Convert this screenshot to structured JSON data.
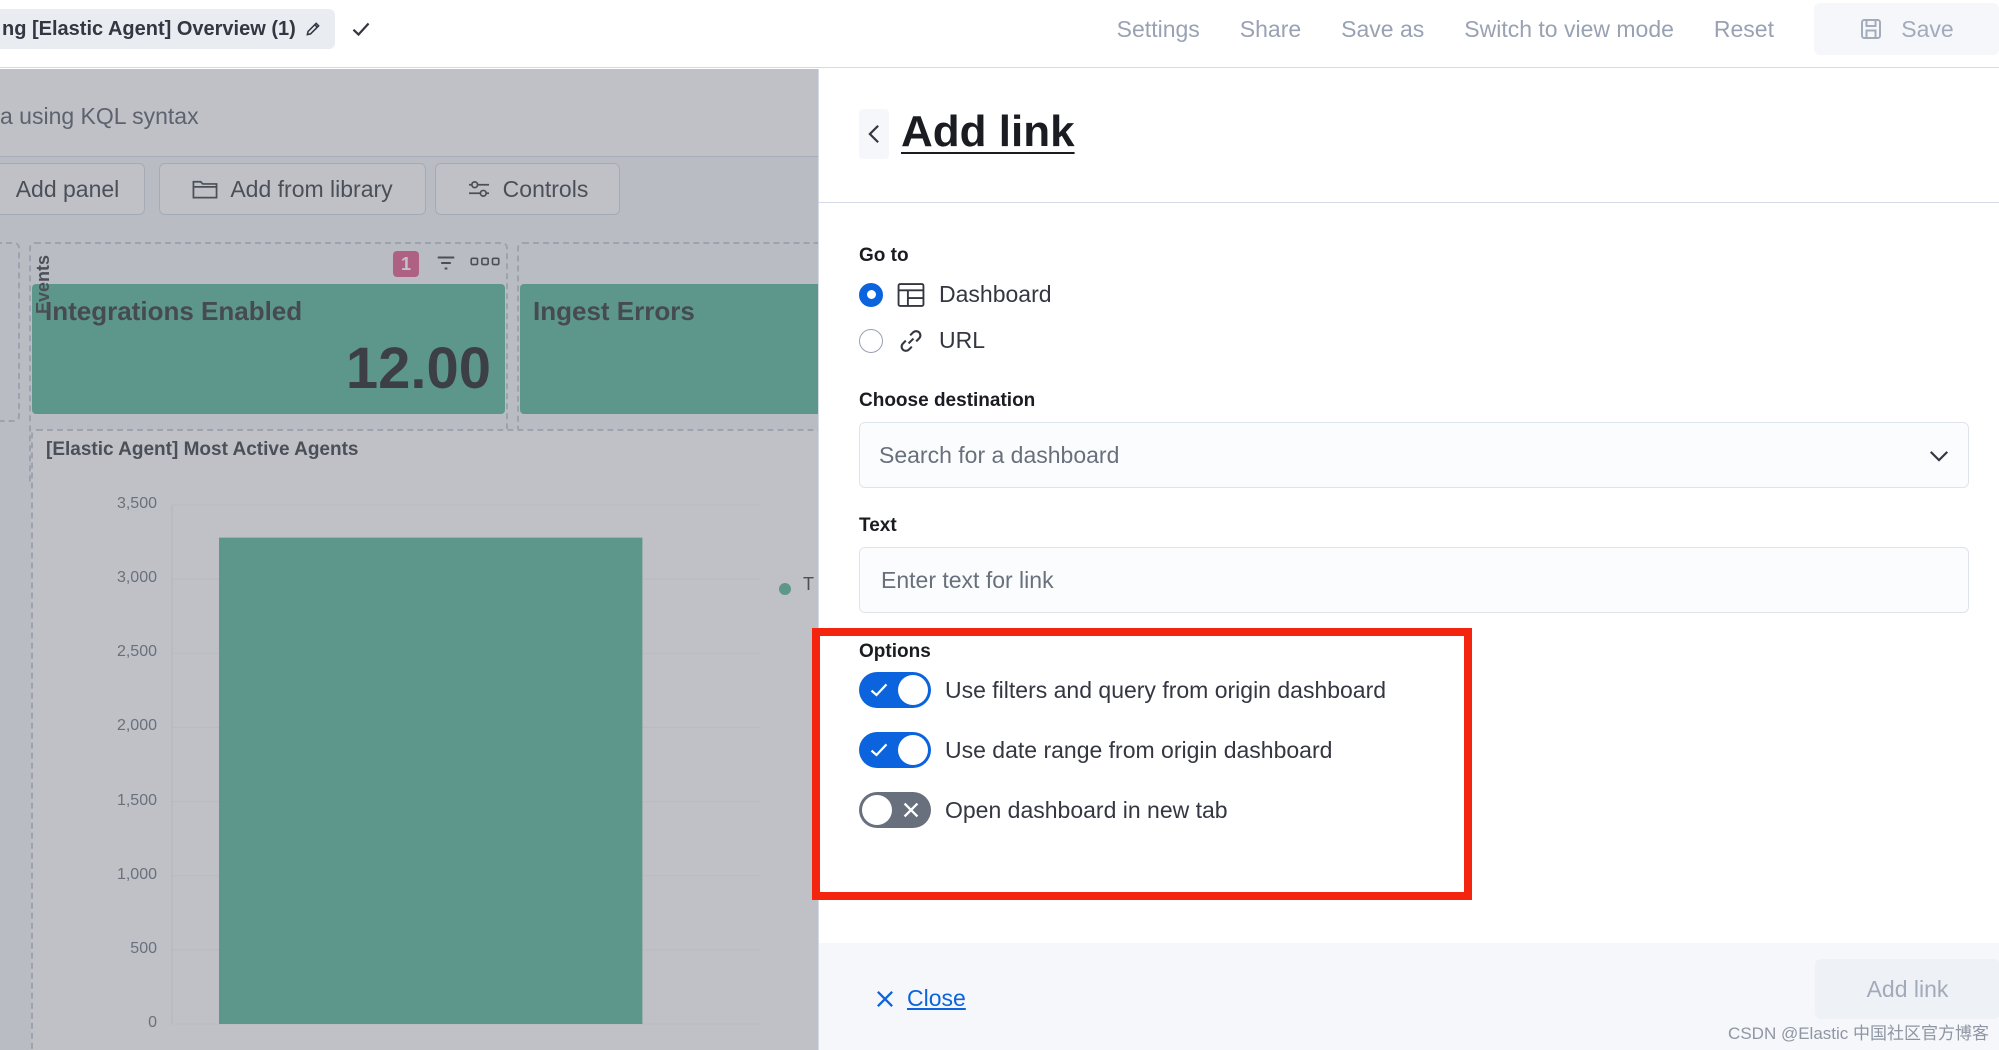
{
  "topbar": {
    "title": "ng [Elastic Agent] Overview (1)",
    "actions": [
      "Settings",
      "Share",
      "Save as",
      "Switch to view mode",
      "Reset"
    ],
    "save_label": "Save"
  },
  "dashboard": {
    "kql_placeholder": "a using KQL syntax",
    "toolbar": {
      "add_panel": "Add panel",
      "add_from_library": "Add from library",
      "controls": "Controls"
    },
    "filter_badge": "1",
    "metrics": [
      {
        "title": "Integrations Enabled",
        "value": "12.00"
      },
      {
        "title": "Ingest Errors",
        "value": ""
      }
    ],
    "chart_title": "[Elastic Agent] Most Active Agents",
    "legend_text": "T"
  },
  "chart_data": {
    "type": "bar",
    "title": "[Elastic Agent] Most Active Agents",
    "ylabel": "Events",
    "xlabel": "",
    "yticks": [
      "3,500",
      "3,000",
      "2,500",
      "2,000",
      "1,500",
      "1,000",
      "500",
      "0"
    ],
    "ylim": [
      0,
      3500
    ],
    "categories": [
      ""
    ],
    "values": [
      3280
    ],
    "colors": [
      "#54b399"
    ]
  },
  "flyout": {
    "title": "Add link",
    "goto_label": "Go to",
    "goto_options": [
      {
        "label": "Dashboard",
        "selected": true
      },
      {
        "label": "URL",
        "selected": false
      }
    ],
    "destination_label": "Choose destination",
    "destination_placeholder": "Search for a dashboard",
    "text_label": "Text",
    "text_placeholder": "Enter text for link",
    "options_label": "Options",
    "options": [
      {
        "label": "Use filters and query from origin dashboard",
        "enabled": true
      },
      {
        "label": "Use date range from origin dashboard",
        "enabled": true
      },
      {
        "label": "Open dashboard in new tab",
        "enabled": false
      }
    ],
    "close_label": "Close",
    "add_label": "Add link"
  },
  "watermark": "CSDN @Elastic 中国社区官方博客",
  "colors": {
    "accent": "#0b64dd",
    "metric_bg": "#54b399",
    "highlight": "#f4250e"
  }
}
